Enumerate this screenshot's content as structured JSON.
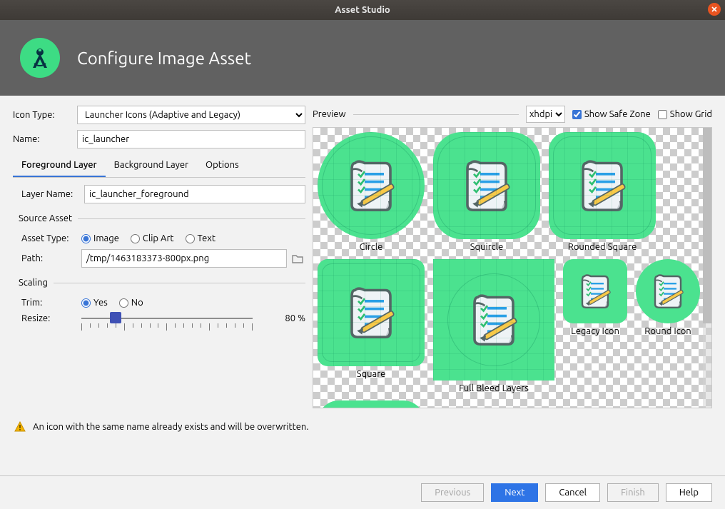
{
  "window": {
    "title": "Asset Studio"
  },
  "header": {
    "title": "Configure Image Asset"
  },
  "form": {
    "icon_type_label": "Icon Type:",
    "icon_type_value": "Launcher Icons (Adaptive and Legacy)",
    "name_label": "Name:",
    "name_value": "ic_launcher",
    "tabs": {
      "fg": "Foreground Layer",
      "bg": "Background Layer",
      "opts": "Options"
    },
    "layer_name_label": "Layer Name:",
    "layer_name_value": "ic_launcher_foreground",
    "source_asset_title": "Source Asset",
    "asset_type_label": "Asset Type:",
    "asset_type_options": {
      "image": "Image",
      "clipart": "Clip Art",
      "text": "Text"
    },
    "path_label": "Path:",
    "path_value": "/tmp/1463183373-800px.png",
    "scaling_title": "Scaling",
    "trim_label": "Trim:",
    "trim_options": {
      "yes": "Yes",
      "no": "No"
    },
    "resize_label": "Resize:",
    "resize_value": "80 %",
    "resize_percent": 80
  },
  "preview": {
    "label": "Preview",
    "density": "xhdpi",
    "density_options": [
      "xhdpi"
    ],
    "safe_zone_label": "Show Safe Zone",
    "safe_zone_checked": true,
    "grid_label": "Show Grid",
    "grid_checked": false,
    "items": {
      "circle": "Circle",
      "squircle": "Squircle",
      "rsquare": "Rounded Square",
      "square": "Square",
      "full": "Full Bleed Layers",
      "legacy": "Legacy Icon",
      "round": "Round Icon"
    }
  },
  "warning_text": "An icon with the same name already exists and will be overwritten.",
  "buttons": {
    "previous": "Previous",
    "next": "Next",
    "cancel": "Cancel",
    "finish": "Finish",
    "help": "Help"
  },
  "colors": {
    "accent": "#3874d6",
    "brand_green": "#4be28f",
    "close": "#e95420"
  }
}
